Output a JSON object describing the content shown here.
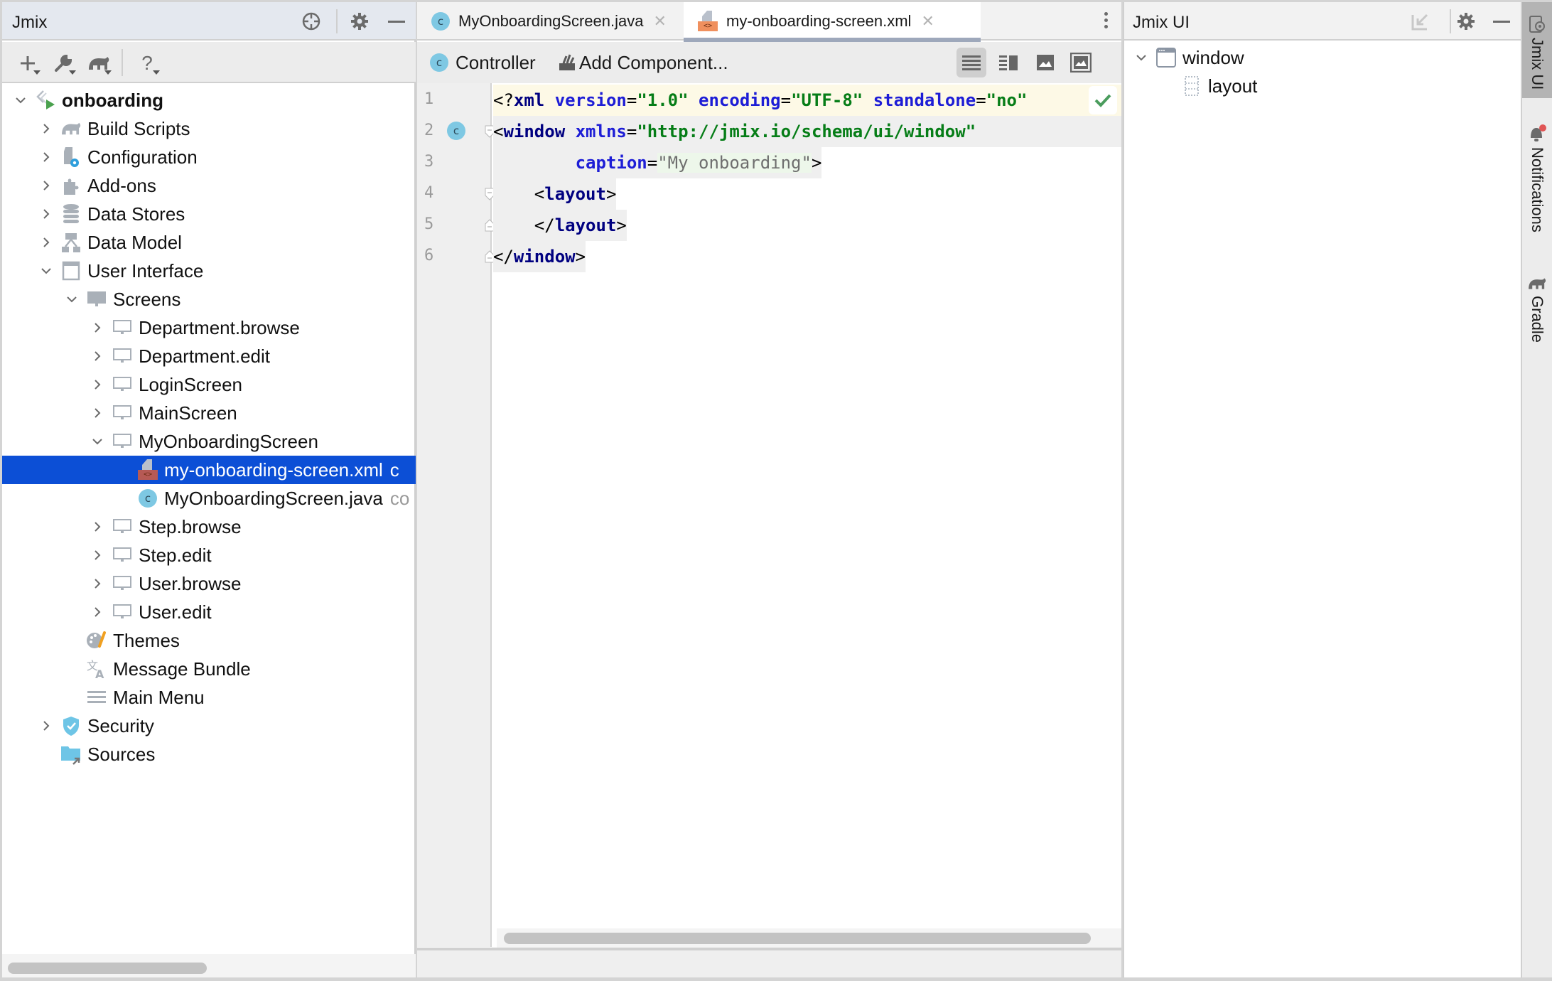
{
  "left_panel": {
    "title": "Jmix",
    "header_icons": [
      "locate-icon",
      "gear-icon",
      "minimize-icon"
    ],
    "toolbar": [
      {
        "name": "new-button",
        "glyph": "+"
      },
      {
        "name": "tools-button",
        "glyph": "wrench"
      },
      {
        "name": "gradle-button",
        "glyph": "elephant"
      },
      {
        "name": "help-button",
        "glyph": "?"
      }
    ],
    "tree": [
      {
        "label": "onboarding",
        "level": 0,
        "expanded": true,
        "icon": "jmix-project-icon",
        "bold": true
      },
      {
        "label": "Build Scripts",
        "level": 1,
        "expanded": false,
        "icon": "gradle-icon"
      },
      {
        "label": "Configuration",
        "level": 1,
        "expanded": false,
        "icon": "config-file-icon"
      },
      {
        "label": "Add-ons",
        "level": 1,
        "expanded": false,
        "icon": "puzzle-icon"
      },
      {
        "label": "Data Stores",
        "level": 1,
        "expanded": false,
        "icon": "database-icon"
      },
      {
        "label": "Data Model",
        "level": 1,
        "expanded": false,
        "icon": "data-model-icon"
      },
      {
        "label": "User Interface",
        "level": 1,
        "expanded": true,
        "icon": "window-icon"
      },
      {
        "label": "Screens",
        "level": 2,
        "expanded": true,
        "icon": "monitor-filled-icon"
      },
      {
        "label": "Department.browse",
        "level": 3,
        "expanded": false,
        "icon": "monitor-icon"
      },
      {
        "label": "Department.edit",
        "level": 3,
        "expanded": false,
        "icon": "monitor-icon"
      },
      {
        "label": "LoginScreen",
        "level": 3,
        "expanded": false,
        "icon": "monitor-icon"
      },
      {
        "label": "MainScreen",
        "level": 3,
        "expanded": false,
        "icon": "monitor-icon"
      },
      {
        "label": "MyOnboardingScreen",
        "level": 3,
        "expanded": true,
        "icon": "monitor-icon"
      },
      {
        "label": "my-onboarding-screen.xml",
        "level": 4,
        "icon": "xml-file-icon",
        "selected": true,
        "suffix": "c"
      },
      {
        "label": "MyOnboardingScreen.java",
        "level": 4,
        "icon": "java-class-icon",
        "suffix": "co"
      },
      {
        "label": "Step.browse",
        "level": 3,
        "expanded": false,
        "icon": "monitor-icon"
      },
      {
        "label": "Step.edit",
        "level": 3,
        "expanded": false,
        "icon": "monitor-icon"
      },
      {
        "label": "User.browse",
        "level": 3,
        "expanded": false,
        "icon": "monitor-icon"
      },
      {
        "label": "User.edit",
        "level": 3,
        "expanded": false,
        "icon": "monitor-icon"
      },
      {
        "label": "Themes",
        "level": 2,
        "icon": "themes-icon"
      },
      {
        "label": "Message Bundle",
        "level": 2,
        "icon": "translate-icon"
      },
      {
        "label": "Main Menu",
        "level": 2,
        "icon": "menu-icon"
      },
      {
        "label": "Security",
        "level": 1,
        "expanded": false,
        "icon": "shield-icon"
      },
      {
        "label": "Sources",
        "level": 1,
        "icon": "sources-folder-icon"
      }
    ]
  },
  "editor": {
    "tabs": [
      {
        "label": "MyOnboardingScreen.java",
        "icon": "java-class-icon",
        "active": false
      },
      {
        "label": "my-onboarding-screen.xml",
        "icon": "xml-file-icon",
        "active": true
      }
    ],
    "toolbar": {
      "controller_label": "Controller",
      "add_component_label": "Add Component...",
      "view_modes": [
        "text-view",
        "split-view",
        "preview-view",
        "preview-only-view"
      ],
      "active_view": "text-view"
    },
    "code_lines": [
      {
        "num": "1",
        "tokens": [
          [
            "plain",
            "<?"
          ],
          [
            "tag",
            "xml"
          ],
          [
            "plain",
            " "
          ],
          [
            "attr",
            "version"
          ],
          [
            "plain",
            "="
          ],
          [
            "val",
            "\"1.0\""
          ],
          [
            "plain",
            " "
          ],
          [
            "attr",
            "encoding"
          ],
          [
            "plain",
            "="
          ],
          [
            "val",
            "\"UTF-8\""
          ],
          [
            "plain",
            " "
          ],
          [
            "attr",
            "standalone"
          ],
          [
            "plain",
            "="
          ],
          [
            "val",
            "\"no\""
          ]
        ]
      },
      {
        "num": "2",
        "tokens": [
          [
            "plain",
            "<"
          ],
          [
            "tag",
            "window"
          ],
          [
            "plain",
            " "
          ],
          [
            "attr",
            "xmlns"
          ],
          [
            "plain",
            "="
          ],
          [
            "val",
            "\"http://jmix.io/schema/ui/window\""
          ]
        ]
      },
      {
        "num": "3",
        "tokens": [
          [
            "plain",
            "        "
          ],
          [
            "attr",
            "caption"
          ],
          [
            "plain",
            "="
          ],
          [
            "valgray",
            "\"My onboarding\""
          ],
          [
            "plain",
            ">"
          ]
        ]
      },
      {
        "num": "4",
        "tokens": [
          [
            "plain",
            "    <"
          ],
          [
            "tag",
            "layout"
          ],
          [
            "plain",
            ">"
          ]
        ]
      },
      {
        "num": "5",
        "tokens": [
          [
            "plain",
            "    </"
          ],
          [
            "tag",
            "layout"
          ],
          [
            "plain",
            ">"
          ]
        ]
      },
      {
        "num": "6",
        "tokens": [
          [
            "plain",
            "</"
          ],
          [
            "tag",
            "window"
          ],
          [
            "plain",
            ">"
          ]
        ]
      }
    ],
    "inspection_status": "ok"
  },
  "right_panel": {
    "title": "Jmix UI",
    "header_icons": [
      "jump-to-source-icon",
      "gear-icon",
      "minimize-icon"
    ],
    "tree": [
      {
        "label": "window",
        "level": 0,
        "expanded": true,
        "icon": "window-component-icon"
      },
      {
        "label": "layout",
        "level": 1,
        "icon": "layout-component-icon"
      }
    ]
  },
  "tool_strip": [
    {
      "label": "Jmix UI",
      "icon": "jmix-ui-icon",
      "active": true
    },
    {
      "label": "Notifications",
      "icon": "bell-icon",
      "active": false,
      "has_badge": true
    },
    {
      "label": "Gradle",
      "icon": "gradle-icon",
      "active": false
    }
  ],
  "colors": {
    "selection": "#0c4fd6",
    "xml_tag": "#000080",
    "xml_attr": "#1d1dd6",
    "xml_value": "#067d17",
    "java_badge": "#7ec8e3",
    "xml_badge": "#f0905e",
    "check": "#4a9c5d",
    "notification_dot": "#e05555"
  }
}
